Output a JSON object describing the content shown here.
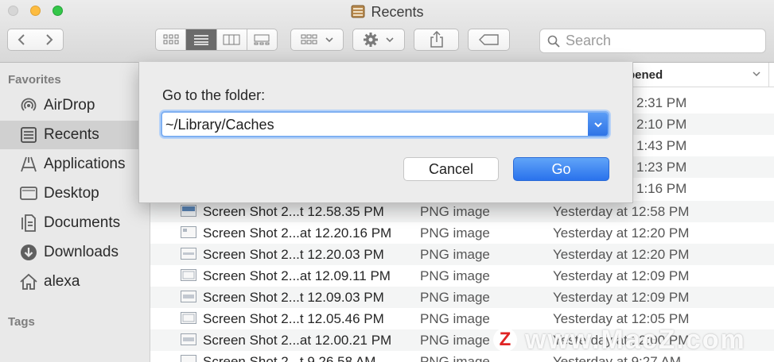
{
  "window": {
    "title": "Recents"
  },
  "toolbar": {
    "search_placeholder": "Search"
  },
  "sidebar": {
    "favorites_header": "Favorites",
    "tags_header": "Tags",
    "items": [
      {
        "label": "AirDrop",
        "icon": "airdrop-icon",
        "selected": false
      },
      {
        "label": "Recents",
        "icon": "recents-icon",
        "selected": true
      },
      {
        "label": "Applications",
        "icon": "applications-icon",
        "selected": false
      },
      {
        "label": "Desktop",
        "icon": "desktop-icon",
        "selected": false
      },
      {
        "label": "Documents",
        "icon": "documents-icon",
        "selected": false
      },
      {
        "label": "Downloads",
        "icon": "downloads-icon",
        "selected": false
      },
      {
        "label": "alexa",
        "icon": "home-icon",
        "selected": false
      }
    ]
  },
  "list": {
    "column_header_fragment": "pened",
    "partial_times": [
      "2:31 PM",
      "2:10 PM",
      "1:43 PM",
      "1:23 PM",
      "1:16 PM"
    ],
    "rows": [
      {
        "name": "Screen Shot 2...t 12.58.35 PM",
        "kind": "PNG image",
        "date": "Yesterday at 12:58 PM"
      },
      {
        "name": "Screen Shot 2...at 12.20.16 PM",
        "kind": "PNG image",
        "date": "Yesterday at 12:20 PM"
      },
      {
        "name": "Screen Shot 2...t 12.20.03 PM",
        "kind": "PNG image",
        "date": "Yesterday at 12:20 PM"
      },
      {
        "name": "Screen Shot 2...at 12.09.11 PM",
        "kind": "PNG image",
        "date": "Yesterday at 12:09 PM"
      },
      {
        "name": "Screen Shot 2...t 12.09.03 PM",
        "kind": "PNG image",
        "date": "Yesterday at 12:09 PM"
      },
      {
        "name": "Screen Shot 2...t 12.05.46 PM",
        "kind": "PNG image",
        "date": "Yesterday at 12:05 PM"
      },
      {
        "name": "Screen Shot 2...at 12.00.21 PM",
        "kind": "PNG image",
        "date": "Yesterday at 12:00 PM"
      },
      {
        "name": "Screen Shot 2...t 9.26.58 AM",
        "kind": "PNG image",
        "date": "Yesterday at 9:27 AM"
      }
    ]
  },
  "sheet": {
    "prompt": "Go to the folder:",
    "path_value": "~/Library/Caches",
    "cancel_label": "Cancel",
    "go_label": "Go"
  },
  "watermark": {
    "badge": "Z",
    "text": "www.MacZ.com"
  },
  "colors": {
    "accent": "#2f74e6",
    "selection": "#d0d0d0",
    "sidebar_bg": "#e9e9e9"
  }
}
